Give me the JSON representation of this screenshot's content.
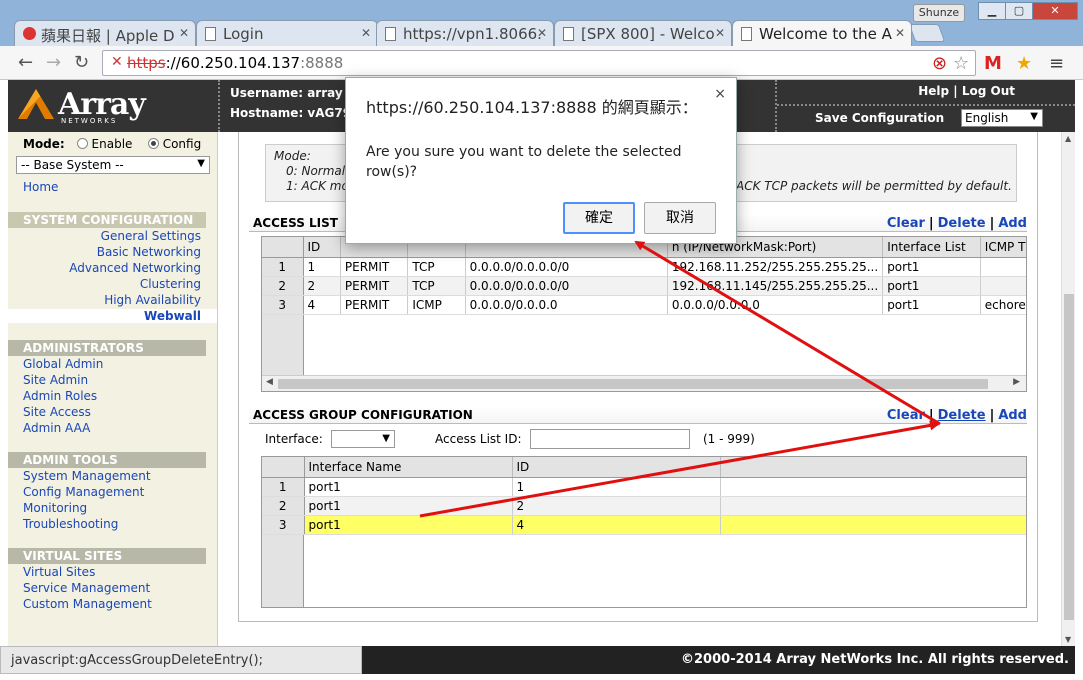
{
  "browser": {
    "tabs": [
      {
        "label": "蘋果日報 | Apple D",
        "icon": "apple-icon"
      },
      {
        "label": "Login",
        "icon": "page-icon"
      },
      {
        "label": "https://vpn1.8066.",
        "icon": "page-icon"
      },
      {
        "label": "[SPX 800] - Welco",
        "icon": "page-icon"
      },
      {
        "label": "Welcome to the A",
        "icon": "page-icon"
      }
    ],
    "profile": "Shunze",
    "url_scheme": "https",
    "url_host": "://60.250.104.137",
    "url_port": ":8888"
  },
  "header": {
    "logo_name": "Array",
    "logo_sub": "NETWORKS",
    "username": "Username: array",
    "hostname": "Hostname: vAG79",
    "help": "Help",
    "logout": "Log Out",
    "separator": "|",
    "save_config": "Save Configuration",
    "language": "English"
  },
  "sidebar": {
    "mode_label": "Mode:",
    "mode_enable": "Enable",
    "mode_config": "Config",
    "system_select": "-- Base System --",
    "home": "Home",
    "sections": [
      {
        "title": "SYSTEM CONFIGURATION",
        "items": [
          "General Settings",
          "Basic Networking",
          "Advanced Networking",
          "Clustering",
          "High Availability",
          "Webwall"
        ]
      },
      {
        "title": "ADMINISTRATORS",
        "items": [
          "Global Admin",
          "Site Admin",
          "Admin Roles",
          "Site Access",
          "Admin AAA"
        ]
      },
      {
        "title": "ADMIN TOOLS",
        "items": [
          "System Management",
          "Config Management",
          "Monitoring",
          "Troubleshooting"
        ]
      },
      {
        "title": "VIRTUAL SITES",
        "items": [
          "Virtual Sites",
          "Service Management",
          "Custom Management"
        ]
      }
    ]
  },
  "mode_note": {
    "title": "Mode:",
    "line0": "0: Normal",
    "line1": "1: ACK mo",
    "tail": "ACK TCP packets will be permitted by default."
  },
  "access_list": {
    "title": "ACCESS LIST",
    "actions": {
      "clear": "Clear",
      "delete": "Delete",
      "add": "Add"
    },
    "columns": [
      "ID",
      "",
      "",
      "",
      "n (IP/NetworkMask:Port)",
      "Interface List",
      "ICMP T"
    ],
    "rows": [
      {
        "n": "1",
        "id": "1",
        "action": "PERMIT",
        "proto": "TCP",
        "src": "0.0.0.0/0.0.0.0/0",
        "dst": "192.168.11.252/255.255.255.25...",
        "iface": "port1",
        "icmp": ""
      },
      {
        "n": "2",
        "id": "2",
        "action": "PERMIT",
        "proto": "TCP",
        "src": "0.0.0.0/0.0.0.0/0",
        "dst": "192.168.11.145/255.255.255.25...",
        "iface": "port1",
        "icmp": ""
      },
      {
        "n": "3",
        "id": "4",
        "action": "PERMIT",
        "proto": "ICMP",
        "src": "0.0.0.0/0.0.0.0",
        "dst": "0.0.0.0/0.0.0.0",
        "iface": "port1",
        "icmp": "echore"
      }
    ]
  },
  "access_group": {
    "title": "ACCESS GROUP CONFIGURATION",
    "actions": {
      "clear": "Clear",
      "delete": "Delete",
      "add": "Add"
    },
    "interface_label": "Interface:",
    "acl_id_label": "Access List ID:",
    "acl_range": "(1 - 999)",
    "columns": [
      "Interface Name",
      "ID"
    ],
    "rows": [
      {
        "n": "1",
        "iface": "port1",
        "id": "1"
      },
      {
        "n": "2",
        "iface": "port1",
        "id": "2"
      },
      {
        "n": "3",
        "iface": "port1",
        "id": "4"
      }
    ]
  },
  "status_bar": "javascript:gAccessGroupDeleteEntry();",
  "footer": "©2000-2014 Array NetWorks Inc. All rights reserved.",
  "dialog": {
    "title": "https://60.250.104.137:8888 的網頁顯示：",
    "close": "×",
    "message": "Are you sure you want to delete the selected row(s)?",
    "ok": "確定",
    "cancel": "取消"
  },
  "colors": {
    "arrow": "#e01010",
    "highlight_row": "#ffff66",
    "link": "#1a47b8"
  }
}
